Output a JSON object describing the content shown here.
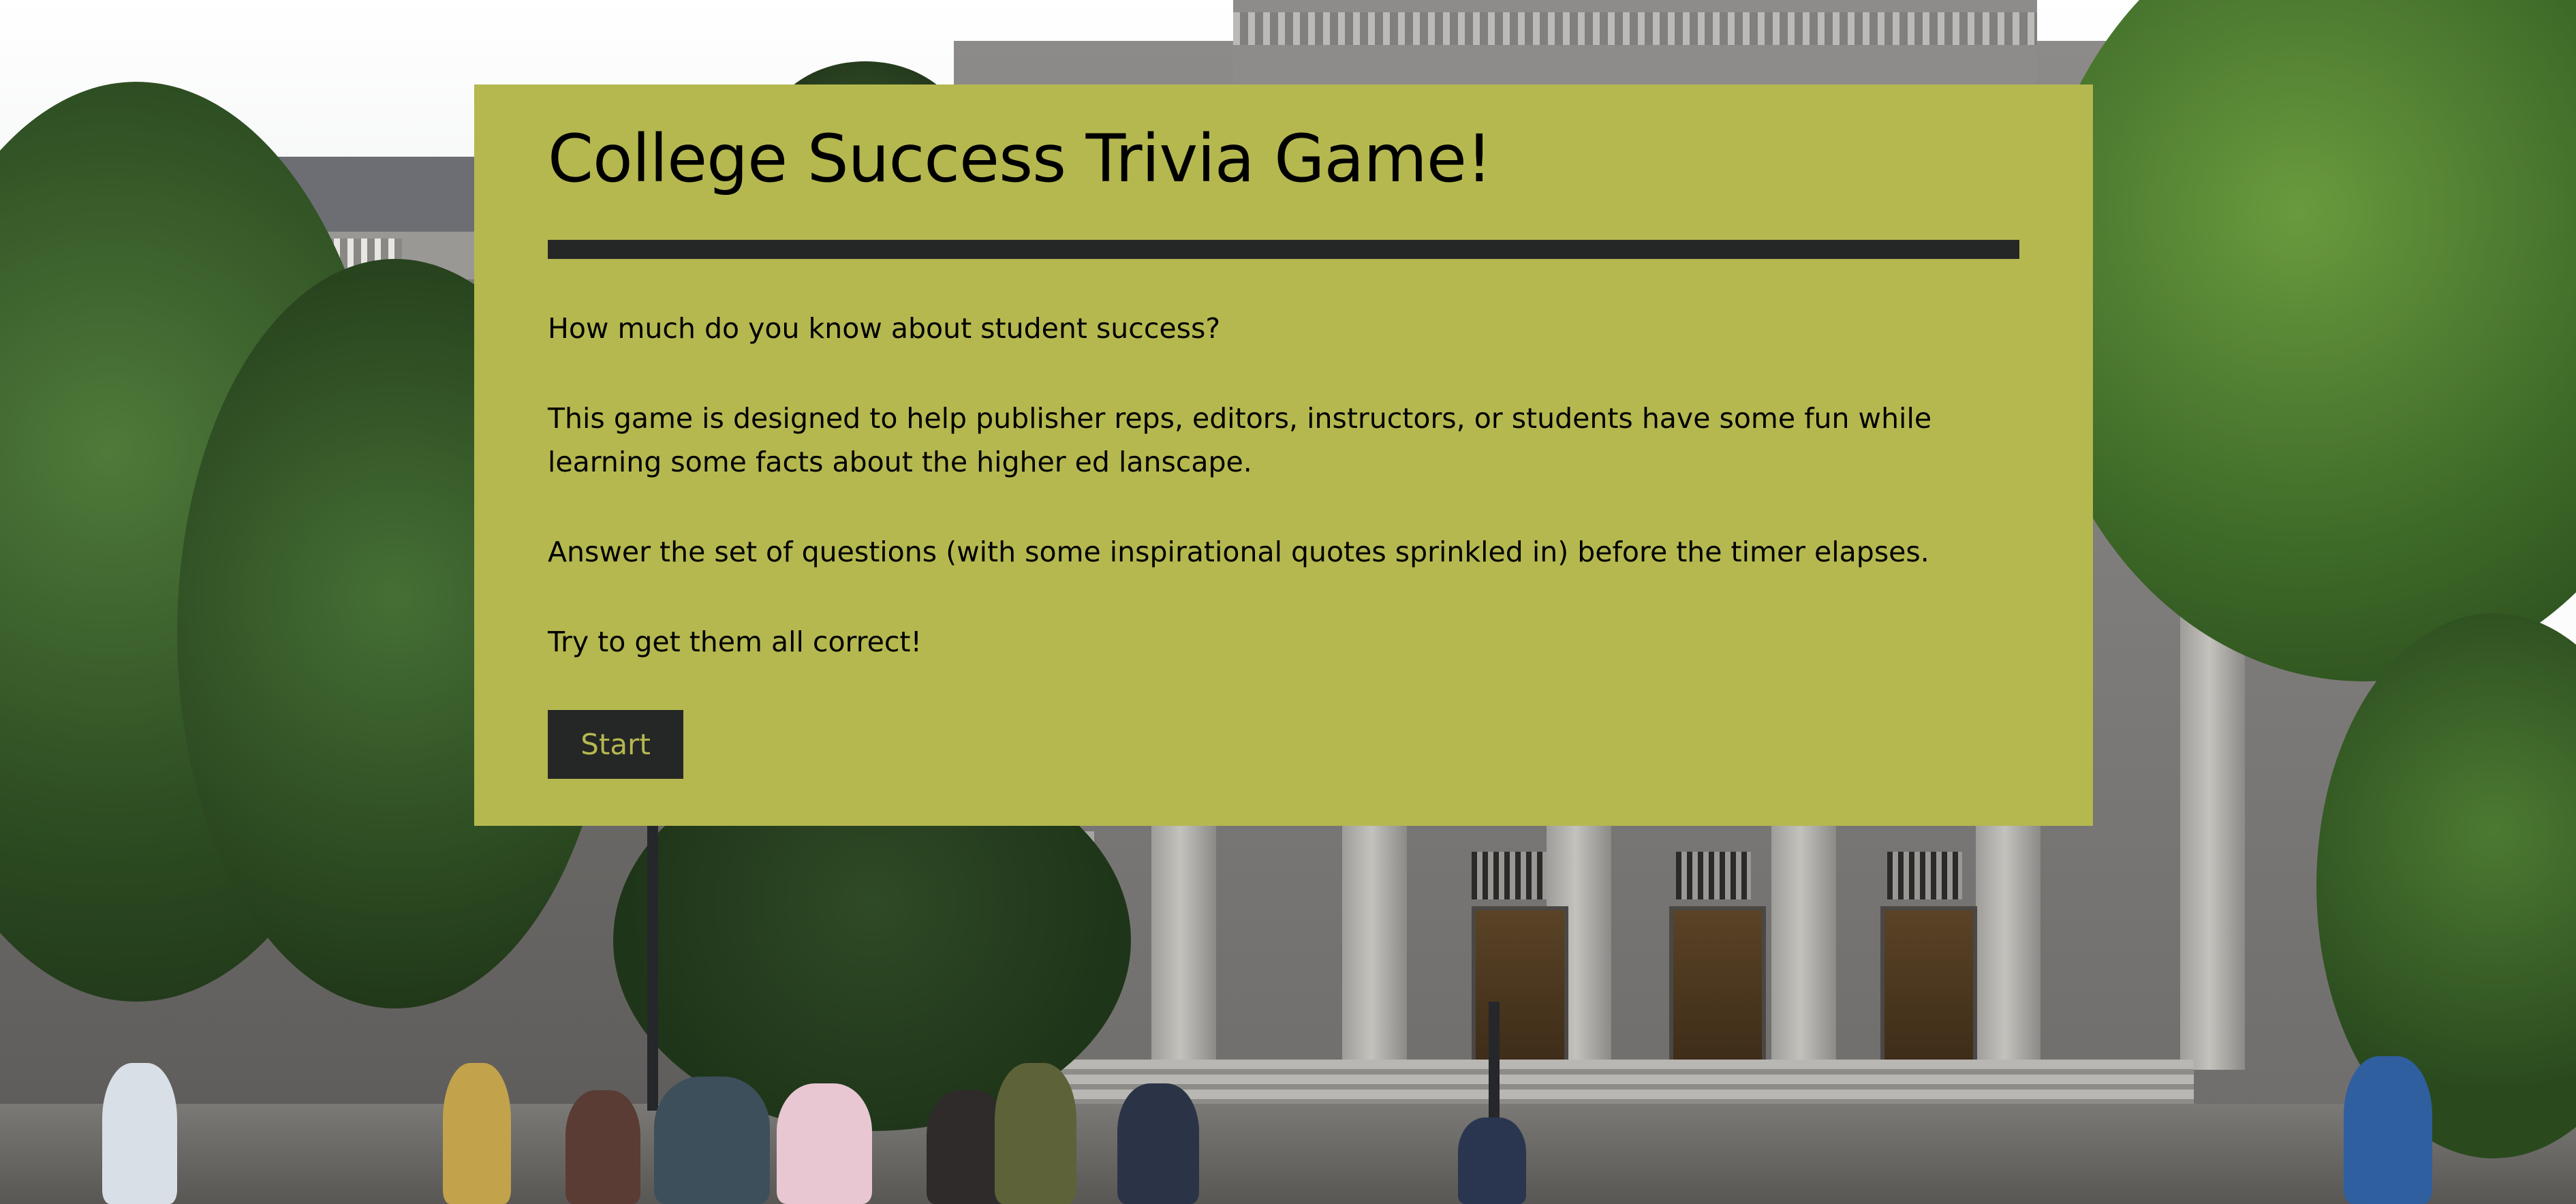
{
  "page": {
    "title": "College Success Trivia Game!"
  },
  "intro": {
    "question": "How much do you know about student success?",
    "description": "This game is designed to help publisher reps, editors, instructors, or students have some fun while learning some facts about the higher ed lanscape.",
    "instructions": "Answer the set of questions (with some inspirational quotes sprinkled in) before the timer elapses.",
    "encouragement": "Try to get them all correct!"
  },
  "actions": {
    "start_label": "Start"
  },
  "colors": {
    "panel_background": "#b5b84f",
    "dark_accent": "#252726",
    "text": "#000000"
  }
}
